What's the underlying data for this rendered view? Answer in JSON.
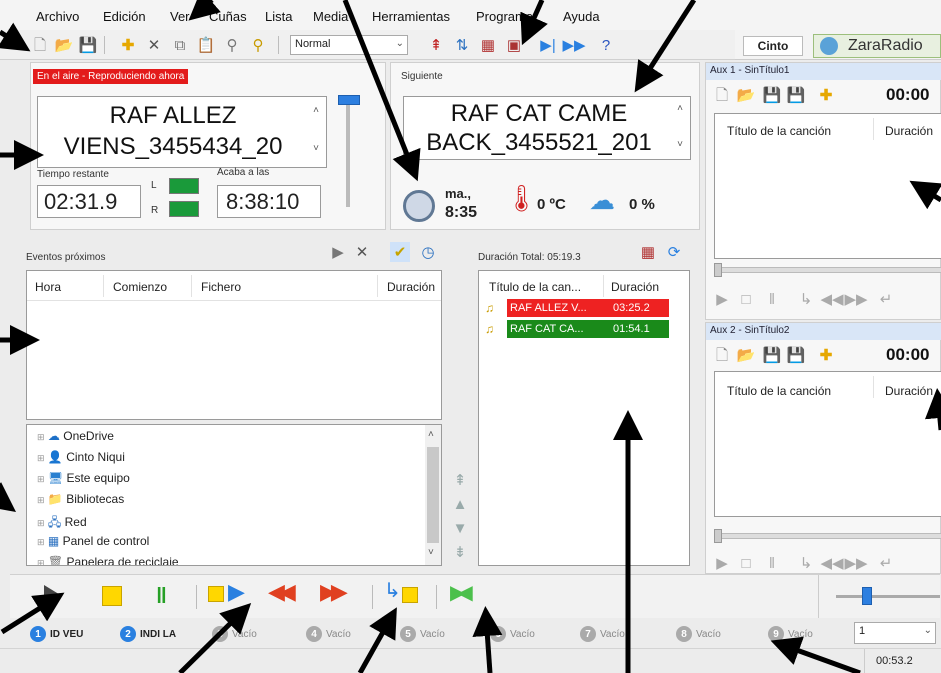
{
  "menu": [
    "Archivo",
    "Edición",
    "Ver",
    "Cuñas",
    "Lista",
    "Media",
    "Herramientas",
    "Programa",
    "Ayuda"
  ],
  "toolbar": {
    "mode_select": "Normal"
  },
  "tabs": {
    "cinto": "Cinto",
    "brand": "ZaraRadio"
  },
  "on_air": {
    "badge": "En el aire - Reproduciendo ahora",
    "line1": "RAF ALLEZ",
    "line2": "VIENS_3455434_20",
    "remaining_label": "Tiempo restante",
    "remaining": "02:31.9",
    "ends_label": "Acaba a las",
    "ends": "8:38:10",
    "l": "L",
    "r": "R"
  },
  "next": {
    "label": "Siguiente",
    "line1": "RAF CAT CAME",
    "line2": "BACK_3455521_201"
  },
  "clock": {
    "day": "ma.,",
    "time": "8:35",
    "temp": "0 ºC",
    "rain": "0 %"
  },
  "events": {
    "title": "Eventos próximos",
    "columns": [
      "Hora",
      "Comienzo",
      "Fichero",
      "Duración"
    ]
  },
  "tree": [
    "OneDrive",
    "Cinto Niqui",
    "Este equipo",
    "Bibliotecas",
    "Red",
    "Panel de control",
    "Papelera de reciclaje"
  ],
  "playlist": {
    "total": "Duración Total: 05:19.3",
    "columns": [
      "Título de la can...",
      "Duración"
    ],
    "rows": [
      {
        "title": "RAF ALLEZ V...",
        "duration": "03:25.2",
        "color": "#ee2222"
      },
      {
        "title": "RAF CAT CA...",
        "duration": "01:54.1",
        "color": "#1a8a1a"
      }
    ]
  },
  "aux1": {
    "title": "Aux 1 - SinTítulo1",
    "time": "00:00",
    "columns": [
      "Título de la canción",
      "Duración"
    ]
  },
  "aux2": {
    "title": "Aux 2 - SinTítulo2",
    "time": "00:00",
    "columns": [
      "Título de la canción",
      "Duración"
    ]
  },
  "slots": [
    {
      "n": "1",
      "label": "ID VEU",
      "active": true
    },
    {
      "n": "2",
      "label": "INDI LA",
      "active": true
    },
    {
      "n": "3",
      "label": "Vacío",
      "active": false
    },
    {
      "n": "4",
      "label": "Vacío",
      "active": false
    },
    {
      "n": "5",
      "label": "Vacío",
      "active": false
    },
    {
      "n": "6",
      "label": "Vacío",
      "active": false
    },
    {
      "n": "7",
      "label": "Vacío",
      "active": false
    },
    {
      "n": "8",
      "label": "Vacío",
      "active": false
    },
    {
      "n": "9",
      "label": "Vacío",
      "active": false
    }
  ],
  "slot_select": "1",
  "status_time": "00:53.2"
}
